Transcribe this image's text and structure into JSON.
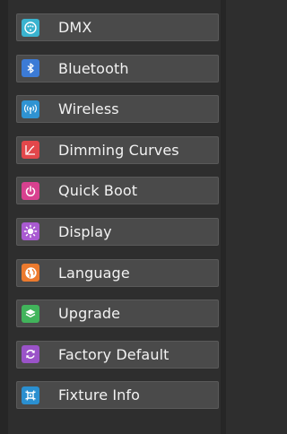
{
  "menu": {
    "items": [
      {
        "label": "DMX",
        "icon": "dmx-connector-icon",
        "color": "#3ab3cf"
      },
      {
        "label": "Bluetooth",
        "icon": "bluetooth-icon",
        "color": "#3c7bd6"
      },
      {
        "label": "Wireless",
        "icon": "wireless-antenna-icon",
        "color": "#2f93d2"
      },
      {
        "label": "Dimming Curves",
        "icon": "dimming-curve-icon",
        "color": "#e2474b"
      },
      {
        "label": "Quick Boot",
        "icon": "power-icon",
        "color": "#d8418f"
      },
      {
        "label": "Display",
        "icon": "brightness-icon",
        "color": "#a95ad1"
      },
      {
        "label": "Language",
        "icon": "globe-icon",
        "color": "#ec7a2e"
      },
      {
        "label": "Upgrade",
        "icon": "layers-icon",
        "color": "#41b45b"
      },
      {
        "label": "Factory Default",
        "icon": "reset-icon",
        "color": "#9a53c8"
      },
      {
        "label": "Fixture Info",
        "icon": "fixture-icon",
        "color": "#2a8fd0"
      }
    ]
  }
}
